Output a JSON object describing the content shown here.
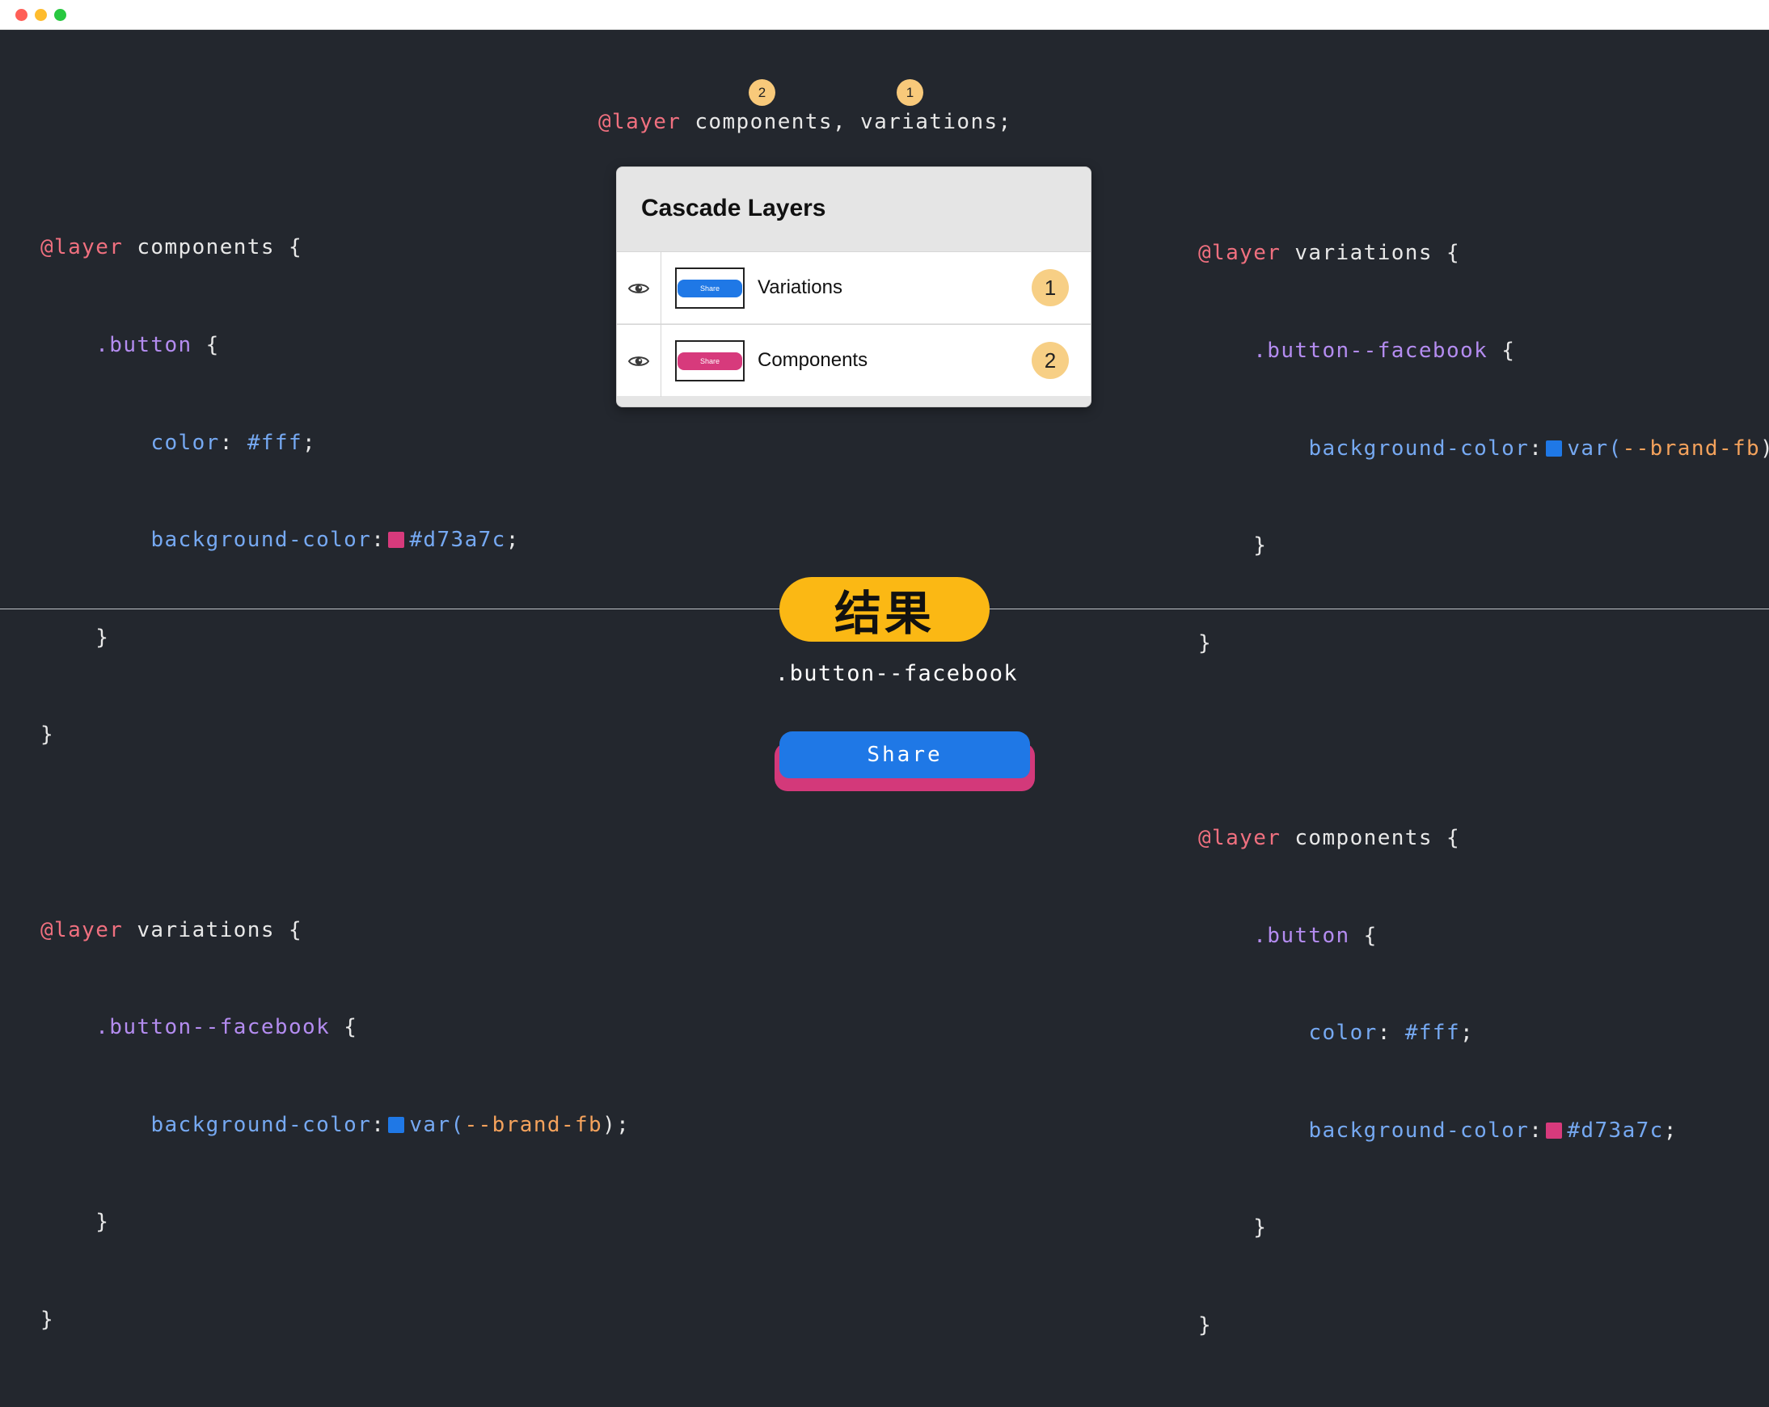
{
  "colors": {
    "background": "#23272e",
    "keyword": "#f0707f",
    "selector": "#b48cf0",
    "property": "#76a9f2",
    "variable": "#f4a25c",
    "components_color": "#d73a7c",
    "facebook_color": "#1f78e6",
    "badge": "#f8c97a",
    "result": "#fbb814"
  },
  "layer_order": {
    "keyword": "@layer",
    "rest": " components, variations;",
    "badge_components": "2",
    "badge_variations": "1"
  },
  "code_left": {
    "l1_kw": "@layer",
    "l1_rest": " components {",
    "l2_sel": ".button",
    "l2_rest": " {",
    "l3_prop": "color",
    "l3_colon": ": ",
    "l3_val": "#fff",
    "l3_end": ";",
    "l4_prop": "background-color",
    "l4_colon": ":",
    "l4_val": "#d73a7c",
    "l4_end": ";",
    "l5": "}",
    "l6": "}",
    "l8_kw": "@layer",
    "l8_rest": " variations {",
    "l9_sel": ".button--facebook",
    "l9_rest": " {",
    "l10_prop": "background-color",
    "l10_colon": ":",
    "l10_fn": "var(",
    "l10_var": "--brand-fb",
    "l10_end": ");",
    "l11": "}",
    "l12": "}"
  },
  "code_right": {
    "l1_kw": "@layer",
    "l1_rest": " variations {",
    "l2_sel": ".button--facebook",
    "l2_rest": " {",
    "l3_prop": "background-color",
    "l3_colon": ":",
    "l3_fn": "var(",
    "l3_var": "--brand-fb",
    "l3_end": ");",
    "l4": "}",
    "l5": "}",
    "l7_kw": "@layer",
    "l7_rest": " components {",
    "l8_sel": ".button",
    "l8_rest": " {",
    "l9_prop": "color",
    "l9_colon": ": ",
    "l9_val": "#fff",
    "l9_end": ";",
    "l10_prop": "background-color",
    "l10_colon": ":",
    "l10_val": "#d73a7c",
    "l10_end": ";",
    "l11": "}",
    "l12": "}"
  },
  "panel": {
    "title": "Cascade Layers",
    "rows": [
      {
        "label": "Variations",
        "badge": "1",
        "thumb_text": "Share",
        "icon": "eye-icon"
      },
      {
        "label": "Components",
        "badge": "2",
        "thumb_text": "Share",
        "icon": "eye-icon"
      }
    ]
  },
  "result": {
    "label": "结果",
    "class_name": ".button--facebook",
    "button_label": "Share"
  }
}
